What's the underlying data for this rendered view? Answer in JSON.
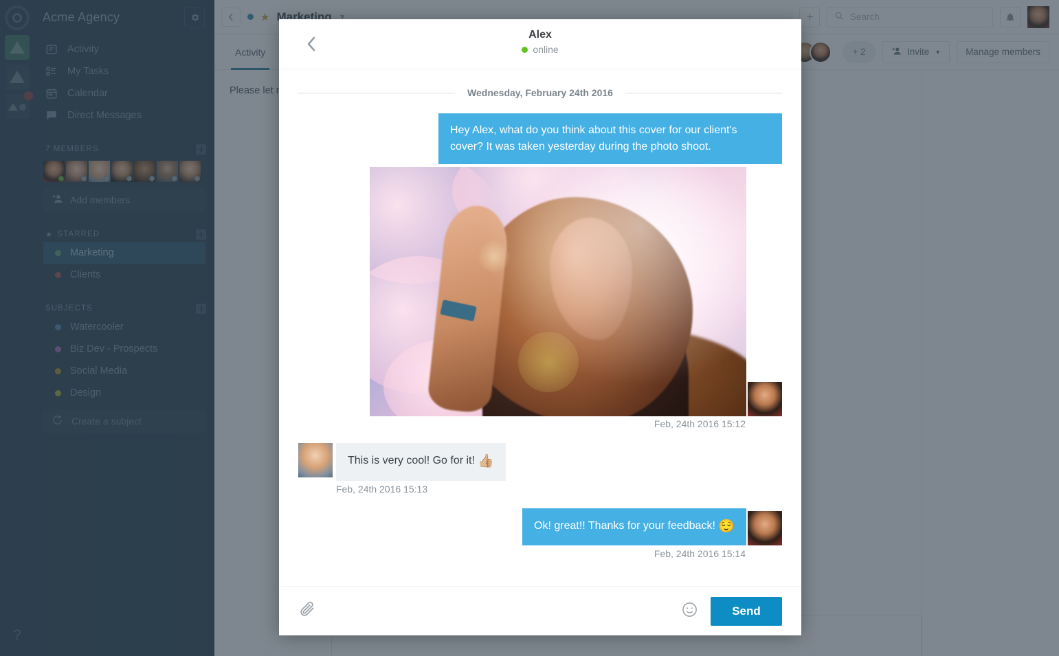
{
  "rail": {
    "logo_icon": "circle-logo-icon",
    "items": [
      {
        "name": "workspace-green",
        "icon": "triangle-icon",
        "badge": false
      },
      {
        "name": "workspace-dim",
        "icon": "triangle-icon",
        "badge": false
      },
      {
        "name": "workspace-notify",
        "icon": "triangle-circle-icon",
        "badge": true
      }
    ],
    "help_label": "?"
  },
  "sidebar": {
    "title": "Acme Agency",
    "gear_icon": "gear-icon",
    "nav": [
      {
        "label": "Activity",
        "icon": "activity-icon"
      },
      {
        "label": "My Tasks",
        "icon": "tasks-icon"
      },
      {
        "label": "Calendar",
        "icon": "calendar-icon"
      },
      {
        "label": "Direct Messages",
        "icon": "chat-icon"
      }
    ],
    "members": {
      "heading": "7 MEMBERS",
      "add_icon": "plus-icon",
      "avatars": [
        {
          "name": "member-avatar-1",
          "status": "online"
        },
        {
          "name": "member-avatar-2",
          "status": "offline"
        },
        {
          "name": "member-avatar-3",
          "status": "offline"
        },
        {
          "name": "member-avatar-4",
          "status": "offline"
        },
        {
          "name": "member-avatar-5",
          "status": "offline"
        },
        {
          "name": "member-avatar-6",
          "status": "offline"
        },
        {
          "name": "member-avatar-7",
          "status": "offline"
        }
      ],
      "add_label": "Add members"
    },
    "starred": {
      "heading": "STARRED",
      "star_icon": "star-icon",
      "add_icon": "plus-icon",
      "items": [
        {
          "label": "Marketing",
          "color": "#5a9e7a",
          "active": true
        },
        {
          "label": "Clients",
          "color": "#a4565b",
          "active": false
        }
      ]
    },
    "subjects": {
      "heading": "SUBJECTS",
      "add_icon": "plus-icon",
      "items": [
        {
          "label": "Watercooler",
          "color": "#4d86b5"
        },
        {
          "label": "Biz Dev - Prospects",
          "color": "#a169b5"
        },
        {
          "label": "Social Media",
          "color": "#b08a2e"
        },
        {
          "label": "Design",
          "color": "#a8aa3c"
        }
      ],
      "create_label": "Create a subject",
      "create_icon": "refresh-plus-icon"
    }
  },
  "topbar": {
    "back_icon": "chevron-left-icon",
    "channel_dot_color": "#3c8fa8",
    "star_icon": "star-icon",
    "channel_name": "Marketing",
    "caret_icon": "chevron-down-icon",
    "add_icon": "plus-icon",
    "search": {
      "icon": "search-icon",
      "value": "",
      "placeholder": "Search"
    },
    "bell_icon": "bell-icon",
    "user_avatar": "user-avatar"
  },
  "subbar": {
    "tabs": [
      {
        "label": "Activity",
        "active": true
      }
    ],
    "plus_count": "+ 2",
    "invite": {
      "label": "Invite",
      "icon": "add-person-icon",
      "caret": "chevron-down-icon"
    },
    "manage_label": "Manage members"
  },
  "background_main": {
    "message_text": "Please let me know if you have any comments."
  },
  "modal": {
    "back_icon": "chevron-left-icon",
    "contact_name": "Alex",
    "status_label": "online",
    "status_color": "#5fc423",
    "date_divider": "Wednesday, February 24th 2016",
    "messages": [
      {
        "type": "text",
        "direction": "out",
        "text": "Hey Alex, what do you think about this cover for our client's cover? It was taken yesterday during the photo shoot.",
        "timestamp": ""
      },
      {
        "type": "image",
        "direction": "out",
        "alt": "Backlit photo of woman with long hair against pink sky",
        "timestamp": "Feb, 24th 2016 15:12"
      },
      {
        "type": "text",
        "direction": "in",
        "text": "This is very cool! Go for it! ",
        "emoji": "👍🏼",
        "timestamp": "Feb, 24th 2016 15:13"
      },
      {
        "type": "text",
        "direction": "out",
        "text": "Ok! great!! Thanks for your feedback! ",
        "emoji": "😌",
        "timestamp": "Feb, 24th 2016 15:14"
      }
    ],
    "footer": {
      "attach_icon": "paperclip-icon",
      "emoji_icon": "smiley-icon",
      "send_label": "Send",
      "send_color": "#0d8dc4"
    }
  }
}
